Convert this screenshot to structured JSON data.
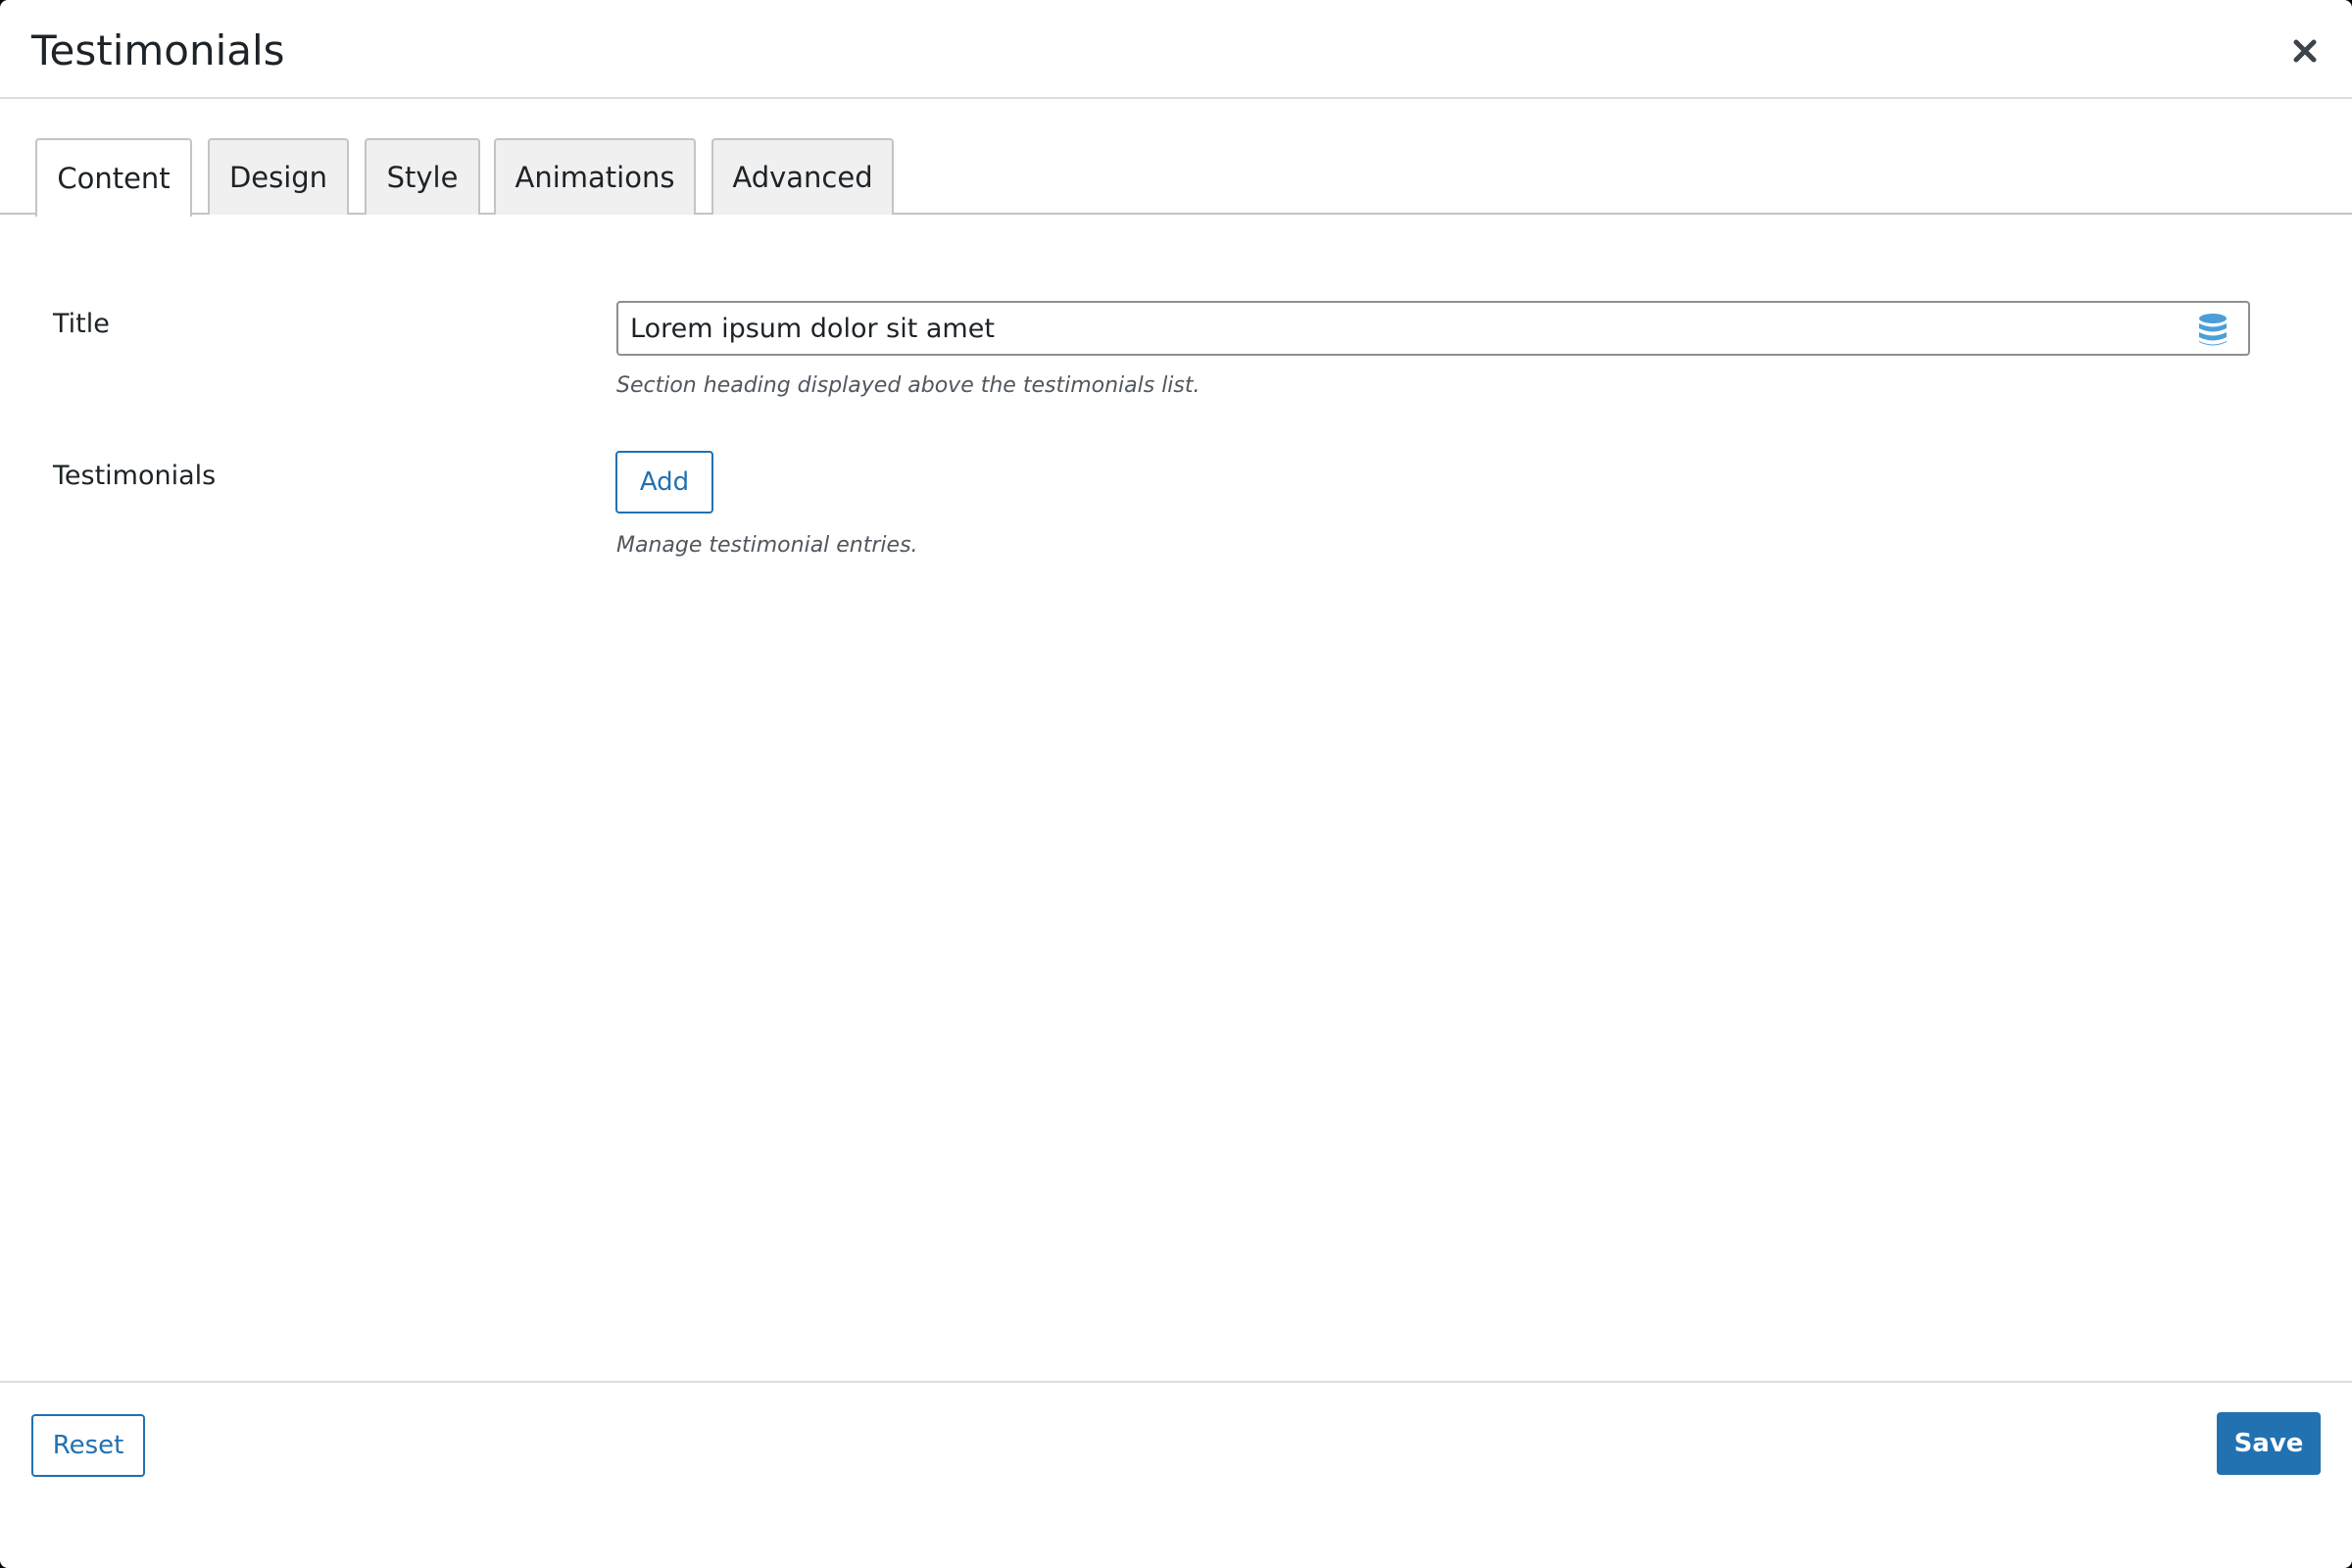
{
  "header": {
    "title": "Testimonials",
    "close_icon": "close-icon"
  },
  "tabs": [
    {
      "label": "Content",
      "active": true
    },
    {
      "label": "Design",
      "active": false
    },
    {
      "label": "Style",
      "active": false
    },
    {
      "label": "Animations",
      "active": false
    },
    {
      "label": "Advanced",
      "active": false
    }
  ],
  "fields": {
    "title": {
      "label": "Title",
      "value": "Lorem ipsum dolor sit amet",
      "help": "Section heading displayed above the testimonials list.",
      "icon": "database-icon"
    },
    "testimonials": {
      "label": "Testimonials",
      "add_label": "Add",
      "help": "Manage testimonial entries."
    }
  },
  "footer": {
    "reset_label": "Reset",
    "save_label": "Save"
  },
  "colors": {
    "accent": "#2271b1",
    "icon_blue": "#4a9fd8",
    "text": "#1d2327",
    "help": "#50575e",
    "border": "#c3c4c7"
  }
}
